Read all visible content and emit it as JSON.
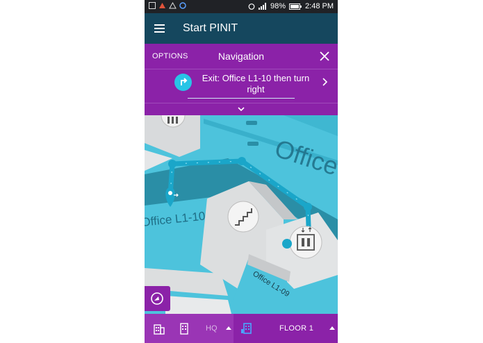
{
  "status_bar": {
    "battery": "98%",
    "time": "2:48 PM"
  },
  "app_bar": {
    "title": "Start PINIT",
    "menu_icon": "hamburger-menu-icon"
  },
  "navigation_panel": {
    "options_label": "OPTIONS",
    "title": "Navigation",
    "instruction": "Exit: Office L1-10 then turn right",
    "turn_icon": "turn-right-icon",
    "close_icon": "close-icon",
    "next_icon": "chevron-right-icon",
    "expand_icon": "chevron-down-icon"
  },
  "map": {
    "room_labels": [
      "Office",
      "Office L1-10",
      "Office L1-09"
    ],
    "icons": [
      "stairs-icon",
      "elevator-icon",
      "restroom-icon",
      "user-location-icon"
    ],
    "route_color": "#1aa6c9"
  },
  "compass_icon": "compass-icon",
  "bottom_bar": {
    "building_icon_1": "building-icon",
    "building_icon_2": "building-icon",
    "building_label": "HQ",
    "floor_icon": "floor-icon",
    "floor_label": "FLOOR 1"
  },
  "colors": {
    "app_bar": "#15475e",
    "accent_purple": "#8b22a8",
    "water_cyan": "#4dc3dc"
  }
}
